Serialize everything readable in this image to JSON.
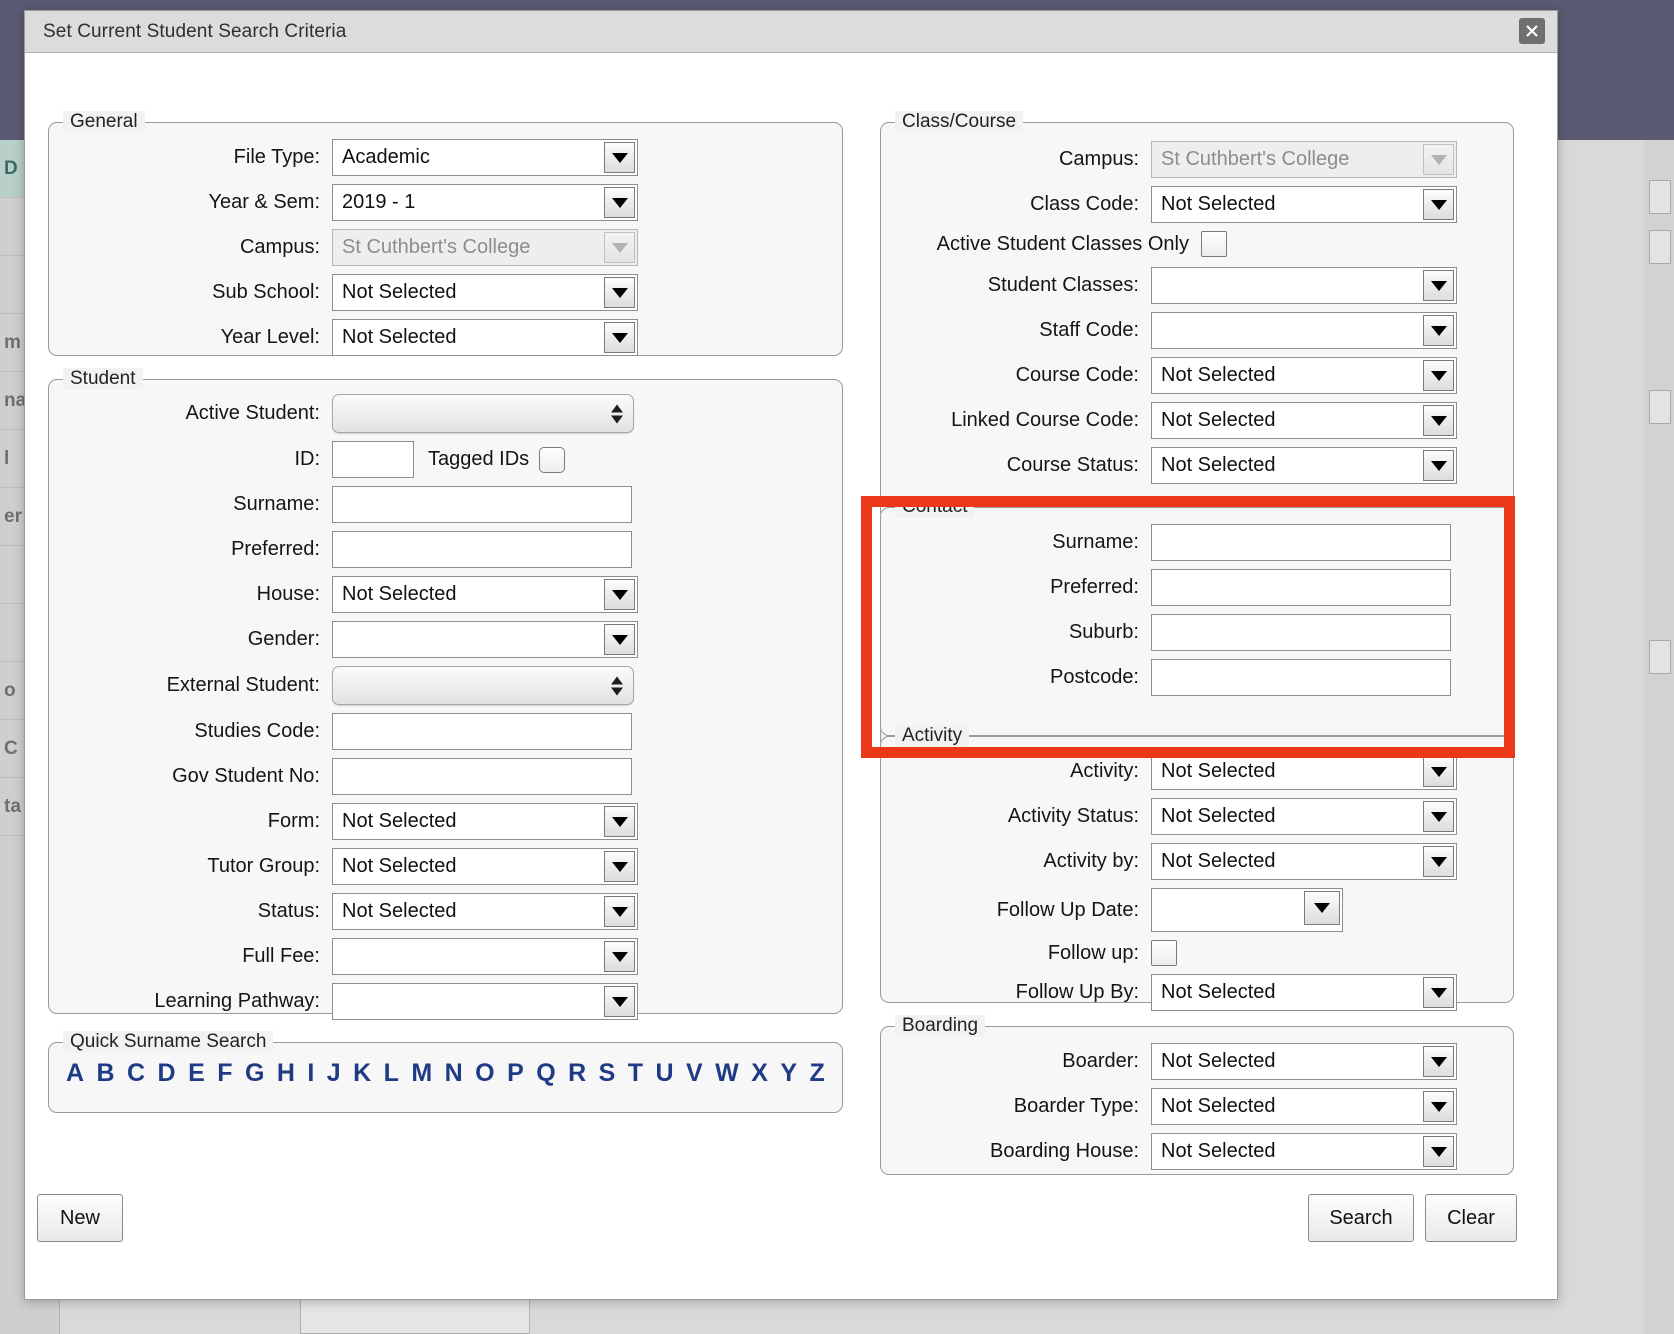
{
  "window": {
    "title": "Set Current Student Search Criteria",
    "close_icon": "close-icon"
  },
  "background": {
    "sidebar_fragments": [
      "D",
      "",
      "",
      "m",
      "na",
      "l",
      "er",
      "",
      "",
      "o",
      "C",
      "ta"
    ]
  },
  "sections": {
    "general": {
      "legend": "General",
      "fields": [
        {
          "label": "File Type:",
          "value": "Academic",
          "type": "dropdown",
          "disabled": false
        },
        {
          "label": "Year & Sem:",
          "value": "2019 - 1",
          "type": "dropdown",
          "disabled": false
        },
        {
          "label": "Campus:",
          "value": "St Cuthbert's College",
          "type": "dropdown",
          "disabled": true
        },
        {
          "label": "Sub School:",
          "value": "Not Selected",
          "type": "dropdown",
          "disabled": false
        },
        {
          "label": "Year Level:",
          "value": "Not Selected",
          "type": "dropdown",
          "disabled": false
        }
      ]
    },
    "student": {
      "legend": "Student",
      "fields": [
        {
          "label": "Active Student:",
          "value": "",
          "type": "popup",
          "disabled": false
        },
        {
          "label": "ID:",
          "value": "",
          "type": "text-small",
          "disabled": false,
          "extra_label": "Tagged IDs",
          "extra_checkbox": false
        },
        {
          "label": "Surname:",
          "value": "",
          "type": "text",
          "disabled": false
        },
        {
          "label": "Preferred:",
          "value": "",
          "type": "text",
          "disabled": false
        },
        {
          "label": "House:",
          "value": "Not Selected",
          "type": "dropdown",
          "disabled": false
        },
        {
          "label": "Gender:",
          "value": "",
          "type": "dropdown",
          "disabled": false
        },
        {
          "label": "External Student:",
          "value": "",
          "type": "popup",
          "disabled": false
        },
        {
          "label": "Studies Code:",
          "value": "",
          "type": "text",
          "disabled": false
        },
        {
          "label": "Gov Student No:",
          "value": "",
          "type": "text",
          "disabled": false
        },
        {
          "label": "Form:",
          "value": "Not Selected",
          "type": "dropdown",
          "disabled": false
        },
        {
          "label": "Tutor Group:",
          "value": "Not Selected",
          "type": "dropdown",
          "disabled": false
        },
        {
          "label": "Status:",
          "value": "Not Selected",
          "type": "dropdown",
          "disabled": false
        },
        {
          "label": "Full Fee:",
          "value": "",
          "type": "dropdown",
          "disabled": false
        },
        {
          "label": "Learning Pathway:",
          "value": "",
          "type": "dropdown",
          "disabled": false
        }
      ]
    },
    "quick_surname_search": {
      "legend": "Quick Surname Search",
      "letters": [
        "A",
        "B",
        "C",
        "D",
        "E",
        "F",
        "G",
        "H",
        "I",
        "J",
        "K",
        "L",
        "M",
        "N",
        "O",
        "P",
        "Q",
        "R",
        "S",
        "T",
        "U",
        "V",
        "W",
        "X",
        "Y",
        "Z"
      ]
    },
    "class_course": {
      "legend": "Class/Course",
      "fields": [
        {
          "label": "Campus:",
          "value": "St Cuthbert's College",
          "type": "dropdown",
          "disabled": true
        },
        {
          "label": "Class Code:",
          "value": "Not Selected",
          "type": "dropdown",
          "disabled": false
        },
        {
          "label": "Active Student Classes Only",
          "value": "",
          "type": "checkbox-right",
          "checked": false
        },
        {
          "label": "Student Classes:",
          "value": "",
          "type": "dropdown",
          "disabled": false
        },
        {
          "label": "Staff Code:",
          "value": "",
          "type": "dropdown",
          "disabled": false
        },
        {
          "label": "Course Code:",
          "value": "Not Selected",
          "type": "dropdown",
          "disabled": false
        },
        {
          "label": "Linked Course Code:",
          "value": "Not Selected",
          "type": "dropdown",
          "disabled": false
        },
        {
          "label": "Course Status:",
          "value": "Not Selected",
          "type": "dropdown",
          "disabled": false
        }
      ]
    },
    "contact": {
      "legend": "Contact",
      "highlighted": true,
      "highlight_color": "#ea3819",
      "fields": [
        {
          "label": "Surname:",
          "value": "",
          "type": "text"
        },
        {
          "label": "Preferred:",
          "value": "",
          "type": "text"
        },
        {
          "label": "Suburb:",
          "value": "",
          "type": "text"
        },
        {
          "label": "Postcode:",
          "value": "",
          "type": "text"
        }
      ]
    },
    "activity": {
      "legend": "Activity",
      "fields": [
        {
          "label": "Activity:",
          "value": "Not Selected",
          "type": "dropdown"
        },
        {
          "label": "Activity Status:",
          "value": "Not Selected",
          "type": "dropdown"
        },
        {
          "label": "Activity by:",
          "value": "Not Selected",
          "type": "dropdown"
        },
        {
          "label": "Follow Up Date:",
          "value": "",
          "type": "date"
        },
        {
          "label": "Follow up:",
          "value": "",
          "type": "checkbox",
          "checked": false
        },
        {
          "label": "Follow Up By:",
          "value": "Not Selected",
          "type": "dropdown"
        }
      ]
    },
    "boarding": {
      "legend": "Boarding",
      "fields": [
        {
          "label": "Boarder:",
          "value": "Not Selected",
          "type": "dropdown"
        },
        {
          "label": "Boarder Type:",
          "value": "Not Selected",
          "type": "dropdown"
        },
        {
          "label": "Boarding House:",
          "value": "Not Selected",
          "type": "dropdown"
        }
      ]
    }
  },
  "footer": {
    "new_label": "New",
    "search_label": "Search",
    "clear_label": "Clear"
  }
}
